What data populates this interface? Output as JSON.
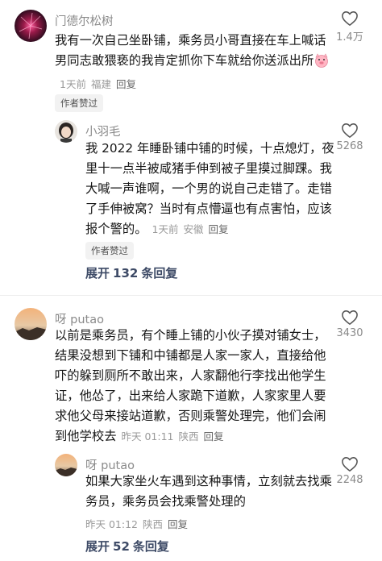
{
  "comments": [
    {
      "username": "门德尔松树",
      "text": "我有一次自己坐卧铺，乘务员小哥直接在车上喊话男同志敢猥亵的我肯定抓你下车就给你送派出所",
      "time": "1天前",
      "location": "福建",
      "reply_label": "回复",
      "likes": "1.4万",
      "badge": "作者赞过",
      "reply": {
        "username": "小羽毛",
        "text": "我 2022 年睡卧铺中铺的时候，十点熄灯，夜里十一点半被咸猪手伸到被子里摸过脚踝。我大喊一声谁啊，一个男的说自己走错了。走错了手伸被窝？当时有点懵逼也有点害怕，应该报个警的。",
        "time": "1天前",
        "location": "安徽",
        "reply_label": "回复",
        "likes": "5268",
        "badge": "作者赞过"
      },
      "expand": {
        "label": "展开",
        "count": "132",
        "suffix": "条回复"
      }
    },
    {
      "username": "呀 putao",
      "text": "以前是乘务员，有个睡上铺的小伙子摸对铺女士，结果没想到下铺和中铺都是人家一家人，直接给他吓的躲到厕所不敢出来，人家翻他行李找出他学生证，他怂了，出来给人家跪下道歉，人家家里人要求他父母来接站道歉，否则乘警处理完，他们会闹到他学校去",
      "time": "昨天 01:11",
      "location": "陕西",
      "reply_label": "回复",
      "likes": "3430",
      "reply": {
        "username": "呀 putao",
        "text": "如果大家坐火车遇到这种事情，立刻就去找乘务员，乘务员会找乘警处理的",
        "time": "昨天 01:12",
        "location": "陕西",
        "reply_label": "回复",
        "likes": "2248"
      },
      "expand": {
        "label": "展开",
        "count": "52",
        "suffix": "条回复"
      }
    }
  ],
  "icons": {
    "like": "heart-outline-icon",
    "emoji": "pig-face-emoji-icon"
  },
  "colors": {
    "link": "#3d4a66",
    "meta": "#9a9a9a"
  }
}
